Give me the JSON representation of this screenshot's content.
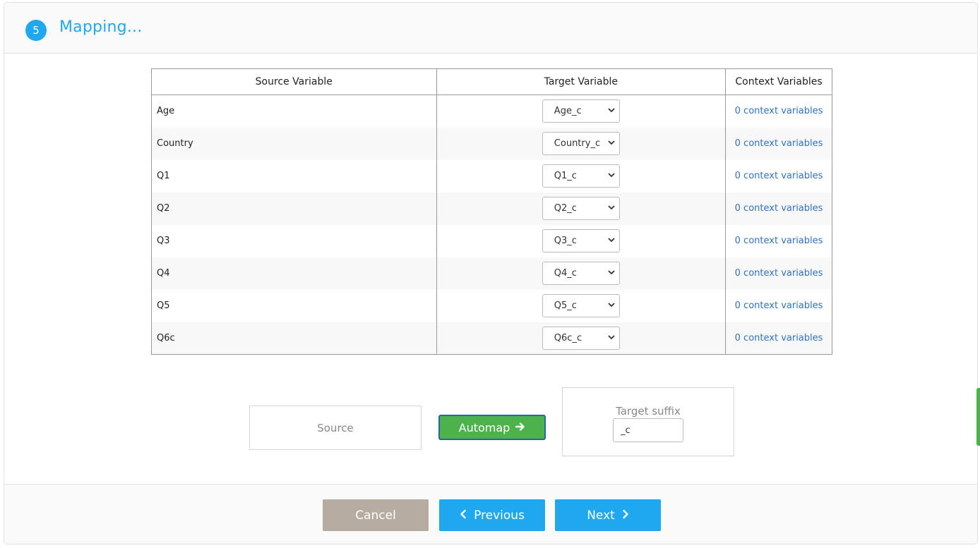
{
  "header": {
    "step_number": "5",
    "title": "Mapping..."
  },
  "table": {
    "columns": [
      "Source Variable",
      "Target Variable",
      "Context Variables"
    ],
    "rows": [
      {
        "source": "Age",
        "target": "Age_c",
        "context": "0 context variables"
      },
      {
        "source": "Country",
        "target": "Country_c",
        "context": "0 context variables"
      },
      {
        "source": "Q1",
        "target": "Q1_c",
        "context": "0 context variables"
      },
      {
        "source": "Q2",
        "target": "Q2_c",
        "context": "0 context variables"
      },
      {
        "source": "Q3",
        "target": "Q3_c",
        "context": "0 context variables"
      },
      {
        "source": "Q4",
        "target": "Q4_c",
        "context": "0 context variables"
      },
      {
        "source": "Q5",
        "target": "Q5_c",
        "context": "0 context variables"
      },
      {
        "source": "Q6c",
        "target": "Q6c_c",
        "context": "0 context variables"
      }
    ]
  },
  "automap": {
    "source_label": "Source",
    "button_label": "Automap",
    "suffix_label": "Target suffix",
    "suffix_value": "_c"
  },
  "footer": {
    "cancel_label": "Cancel",
    "previous_label": "Previous",
    "next_label": "Next"
  },
  "colors": {
    "accent": "#1fa8f0",
    "automap": "#4cb34c",
    "cancel": "#b7aca0",
    "link": "#2f72c4"
  }
}
